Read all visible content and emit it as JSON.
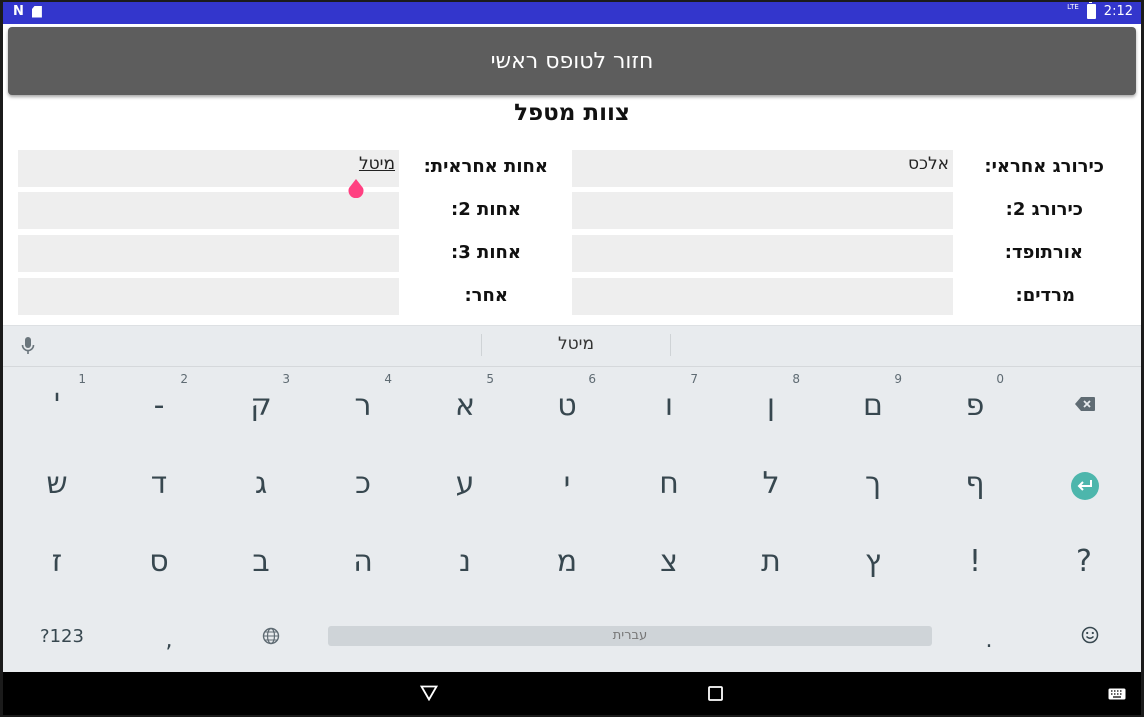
{
  "status_bar": {
    "time": "2:12",
    "network": "LTE"
  },
  "header": {
    "back_button_label": "חזור לטופס ראשי"
  },
  "page_title": "צוות מטפל",
  "form": {
    "right": [
      {
        "label": "כירורג אחראי:",
        "value": "אלכס"
      },
      {
        "label": "כירורג 2:",
        "value": ""
      },
      {
        "label": "אורתופד:",
        "value": ""
      },
      {
        "label": "מרדים:",
        "value": ""
      }
    ],
    "left": [
      {
        "label": "אחות אחראית:",
        "value": "מיטל"
      },
      {
        "label": "אחות 2:",
        "value": ""
      },
      {
        "label": "אחות 3:",
        "value": ""
      },
      {
        "label": "אחר:",
        "value": ""
      }
    ]
  },
  "keyboard": {
    "suggestion": "מיטל",
    "row1": [
      {
        "key": "'",
        "hint": "1"
      },
      {
        "key": "-",
        "hint": "2"
      },
      {
        "key": "ק",
        "hint": "3"
      },
      {
        "key": "ר",
        "hint": "4"
      },
      {
        "key": "א",
        "hint": "5"
      },
      {
        "key": "ט",
        "hint": "6"
      },
      {
        "key": "ו",
        "hint": "7"
      },
      {
        "key": "ן",
        "hint": "8"
      },
      {
        "key": "ם",
        "hint": "9"
      },
      {
        "key": "פ",
        "hint": "0"
      }
    ],
    "row2": [
      "ש",
      "ד",
      "ג",
      "כ",
      "ע",
      "י",
      "ח",
      "ל",
      "ך",
      "ף"
    ],
    "row3": [
      "ז",
      "ס",
      "ב",
      "ה",
      "נ",
      "מ",
      "צ",
      "ת",
      "ץ",
      "!",
      "?"
    ],
    "symbols_label": "?123",
    "comma": ",",
    "period": ".",
    "space_label": "עברית"
  },
  "colors": {
    "status_bar": "#3336cc",
    "button": "#5d5d5d",
    "enter": "#4db6ac",
    "cursor_handle": "#ff4081"
  }
}
